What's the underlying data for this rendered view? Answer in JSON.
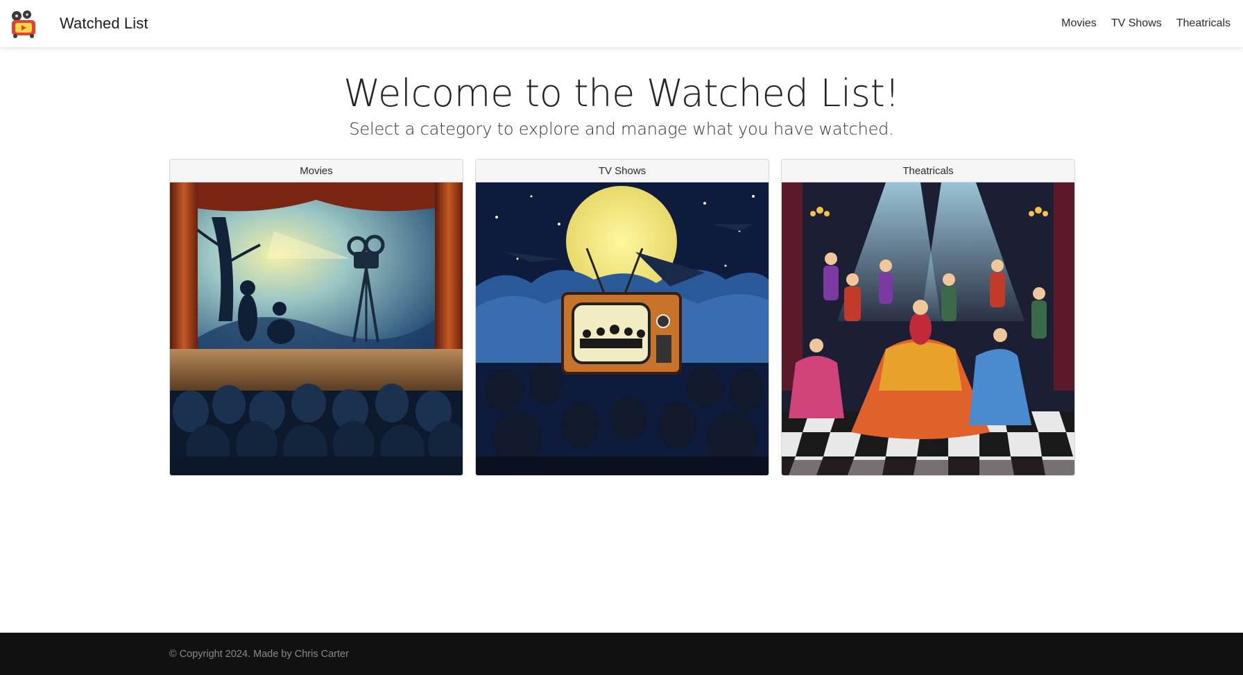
{
  "app": {
    "title": "Watched List",
    "logo_icon": "film-reel-play-icon"
  },
  "nav": {
    "items": [
      {
        "label": "Movies"
      },
      {
        "label": "TV Shows"
      },
      {
        "label": "Theatricals"
      }
    ]
  },
  "hero": {
    "title": "Welcome to the Watched List!",
    "subtitle": "Select a category to explore and manage what you have watched."
  },
  "cards": [
    {
      "title": "Movies",
      "image": "movie-theater-illustration"
    },
    {
      "title": "TV Shows",
      "image": "tv-audience-illustration"
    },
    {
      "title": "Theatricals",
      "image": "theater-dancers-illustration"
    }
  ],
  "footer": {
    "text": "© Copyright 2024. Made by Chris Carter"
  },
  "colors": {
    "footer_bg": "#111111",
    "card_header_bg": "#f5f5f5",
    "logo_red": "#e8402f"
  }
}
